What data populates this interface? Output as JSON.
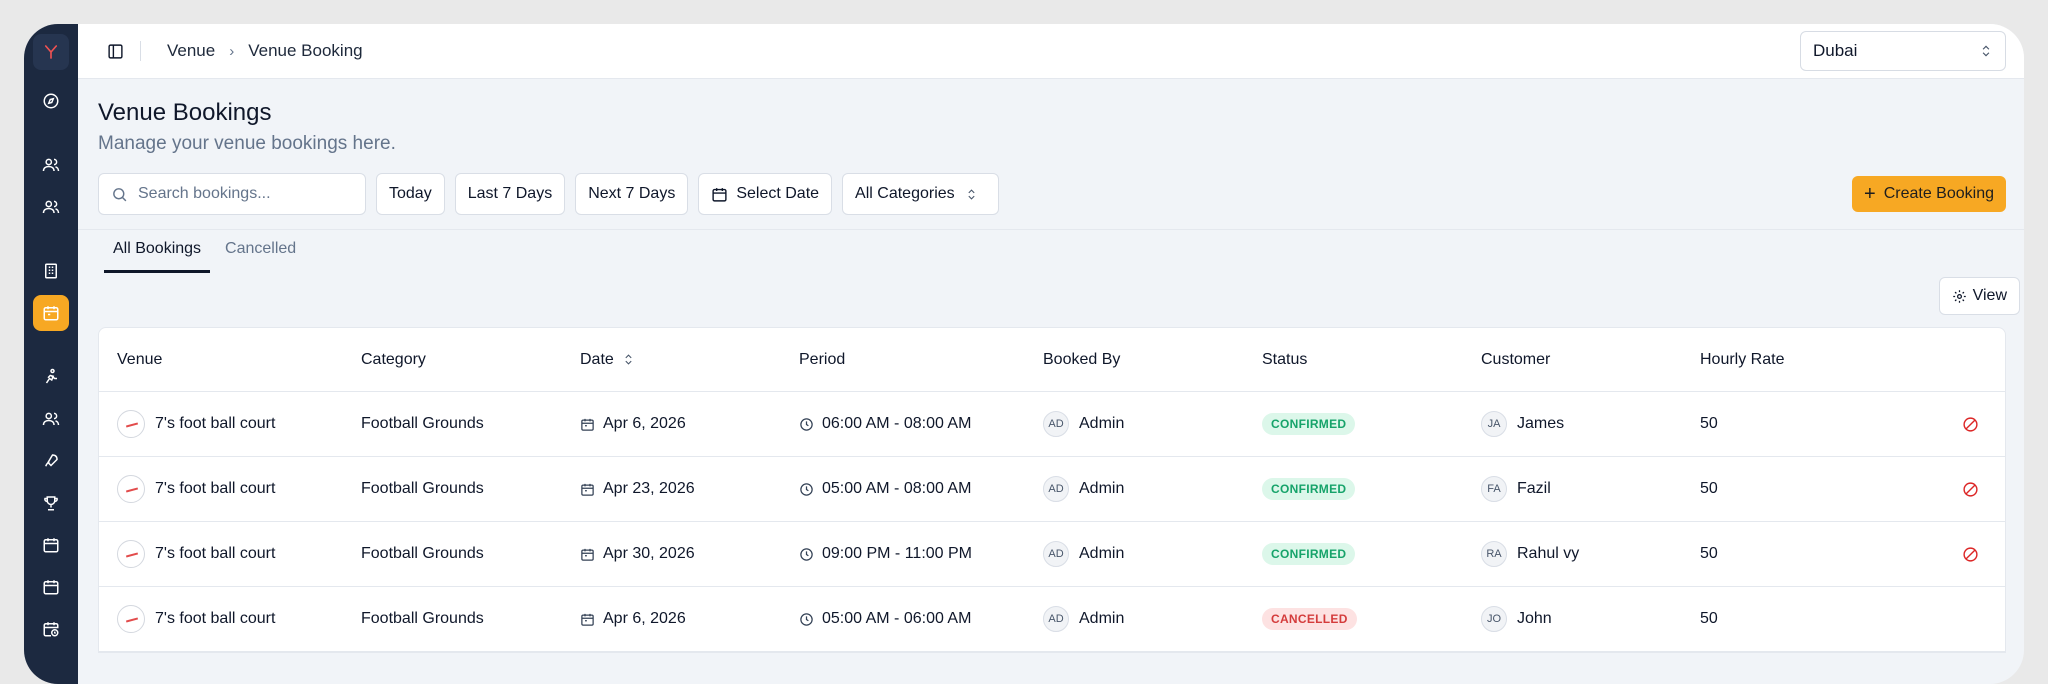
{
  "breadcrumb": {
    "parent": "Venue",
    "current": "Venue Booking"
  },
  "city_select": {
    "value": "Dubai"
  },
  "page": {
    "title": "Venue Bookings",
    "subtitle": "Manage your venue bookings here."
  },
  "filters": {
    "search_placeholder": "Search bookings...",
    "today": "Today",
    "last7": "Last 7 Days",
    "next7": "Next 7 Days",
    "select_date": "Select Date",
    "categories": "All Categories"
  },
  "create_label": "Create Booking",
  "tabs": [
    {
      "label": "All Bookings"
    },
    {
      "label": "Cancelled"
    }
  ],
  "view_label": "View",
  "columns": [
    "Venue",
    "Category",
    "Date",
    "Period",
    "Booked By",
    "Status",
    "Customer",
    "Hourly Rate"
  ],
  "rows": [
    {
      "venue": "7's foot ball court",
      "category": "Football Grounds",
      "date": "Apr 6, 2026",
      "period": "06:00 AM - 08:00 AM",
      "booked_by_initials": "AD",
      "booked_by": "Admin",
      "status": "CONFIRMED",
      "customer_initials": "JA",
      "customer": "James",
      "rate": "50"
    },
    {
      "venue": "7's foot ball court",
      "category": "Football Grounds",
      "date": "Apr 23, 2026",
      "period": "05:00 AM - 08:00 AM",
      "booked_by_initials": "AD",
      "booked_by": "Admin",
      "status": "CONFIRMED",
      "customer_initials": "FA",
      "customer": "Fazil",
      "rate": "50"
    },
    {
      "venue": "7's foot ball court",
      "category": "Football Grounds",
      "date": "Apr 30, 2026",
      "period": "09:00 PM - 11:00 PM",
      "booked_by_initials": "AD",
      "booked_by": "Admin",
      "status": "CONFIRMED",
      "customer_initials": "RA",
      "customer": "Rahul vy",
      "rate": "50"
    },
    {
      "venue": "7's foot ball court",
      "category": "Football Grounds",
      "date": "Apr 6, 2026",
      "period": "05:00 AM - 06:00 AM",
      "booked_by_initials": "AD",
      "booked_by": "Admin",
      "status": "CANCELLED",
      "customer_initials": "JO",
      "customer": "John",
      "rate": "50"
    }
  ],
  "colors": {
    "accent": "#f7a823",
    "sidebar": "#1c2940",
    "confirmed": "#16a36a",
    "cancelled": "#d43c3c"
  }
}
